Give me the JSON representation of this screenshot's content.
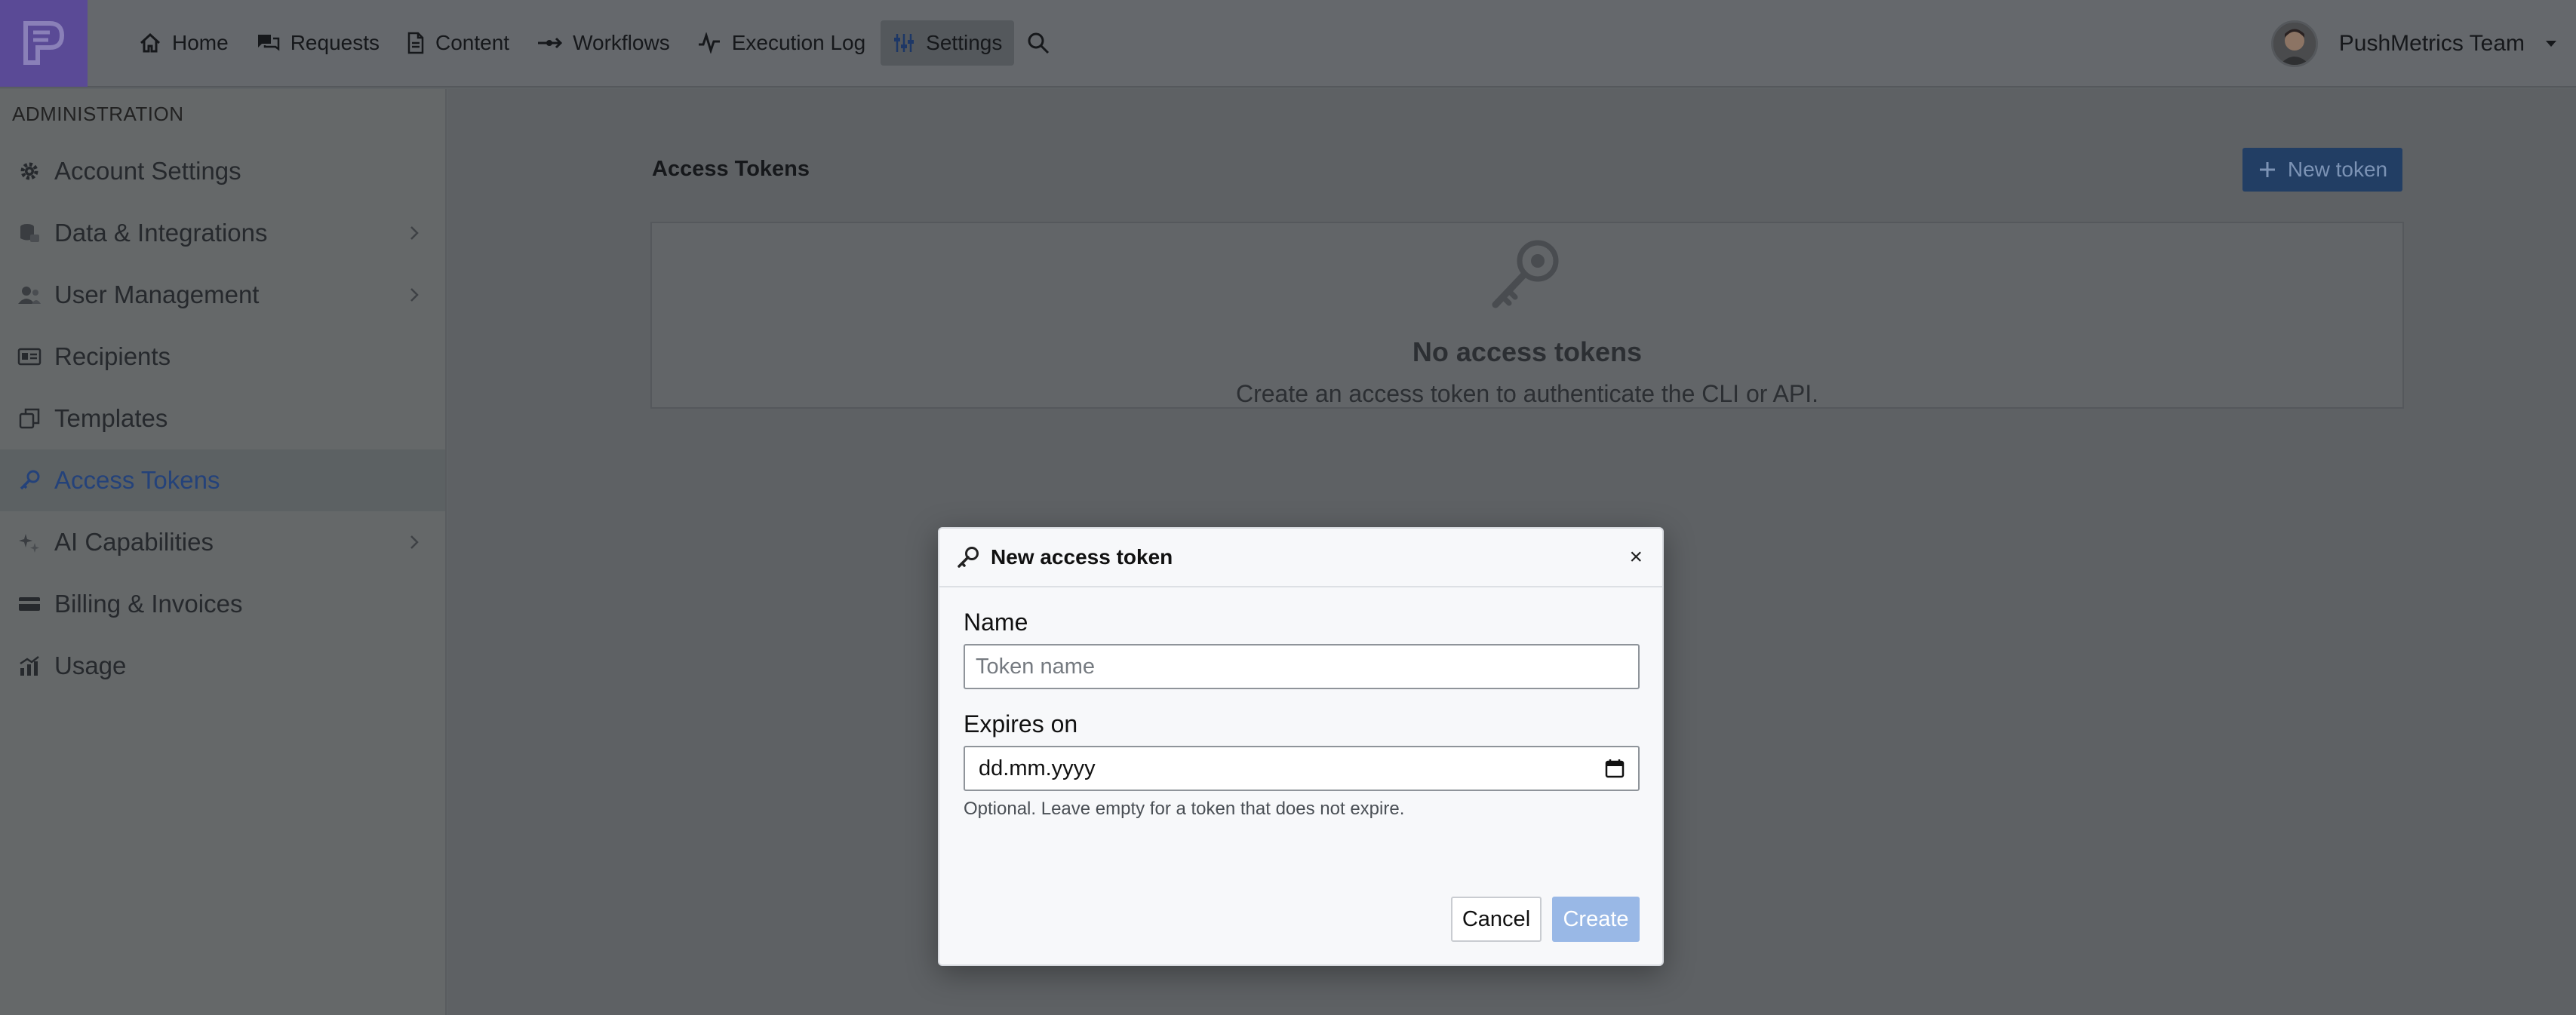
{
  "nav": {
    "items": [
      {
        "label": "Home",
        "icon": "home-icon"
      },
      {
        "label": "Requests",
        "icon": "chat-icon"
      },
      {
        "label": "Content",
        "icon": "document-icon"
      },
      {
        "label": "Workflows",
        "icon": "workflow-icon"
      },
      {
        "label": "Execution Log",
        "icon": "activity-icon"
      },
      {
        "label": "Settings",
        "icon": "sliders-icon",
        "active": true
      }
    ]
  },
  "user": {
    "name": "PushMetrics Team"
  },
  "sidebar": {
    "heading": "ADMINISTRATION",
    "items": [
      {
        "label": "Account Settings",
        "icon": "gear-icon"
      },
      {
        "label": "Data & Integrations",
        "icon": "database-icon",
        "has_submenu": true
      },
      {
        "label": "User Management",
        "icon": "users-icon",
        "has_submenu": true
      },
      {
        "label": "Recipients",
        "icon": "id-card-icon"
      },
      {
        "label": "Templates",
        "icon": "copy-icon"
      },
      {
        "label": "Access Tokens",
        "icon": "key-icon",
        "active": true
      },
      {
        "label": "AI Capabilities",
        "icon": "sparkles-icon",
        "has_submenu": true
      },
      {
        "label": "Billing & Invoices",
        "icon": "credit-card-icon"
      },
      {
        "label": "Usage",
        "icon": "chart-icon"
      }
    ]
  },
  "main": {
    "title": "Access Tokens",
    "new_token_label": "New token",
    "empty_title": "No access tokens",
    "empty_subtitle": "Create an access token to authenticate the CLI or API."
  },
  "modal": {
    "title": "New access token",
    "close_label": "×",
    "name_label": "Name",
    "name_placeholder": "Token name",
    "expires_label": "Expires on",
    "expires_value": "dd.mm.yyyy",
    "expires_help": "Optional. Leave empty for a token that does not expire.",
    "cancel_label": "Cancel",
    "create_label": "Create"
  },
  "colors": {
    "brand": "#6a56b8",
    "primary": "#2b5aa8",
    "create_disabled": "#99b8e6",
    "active_link": "#2b5aa8"
  }
}
